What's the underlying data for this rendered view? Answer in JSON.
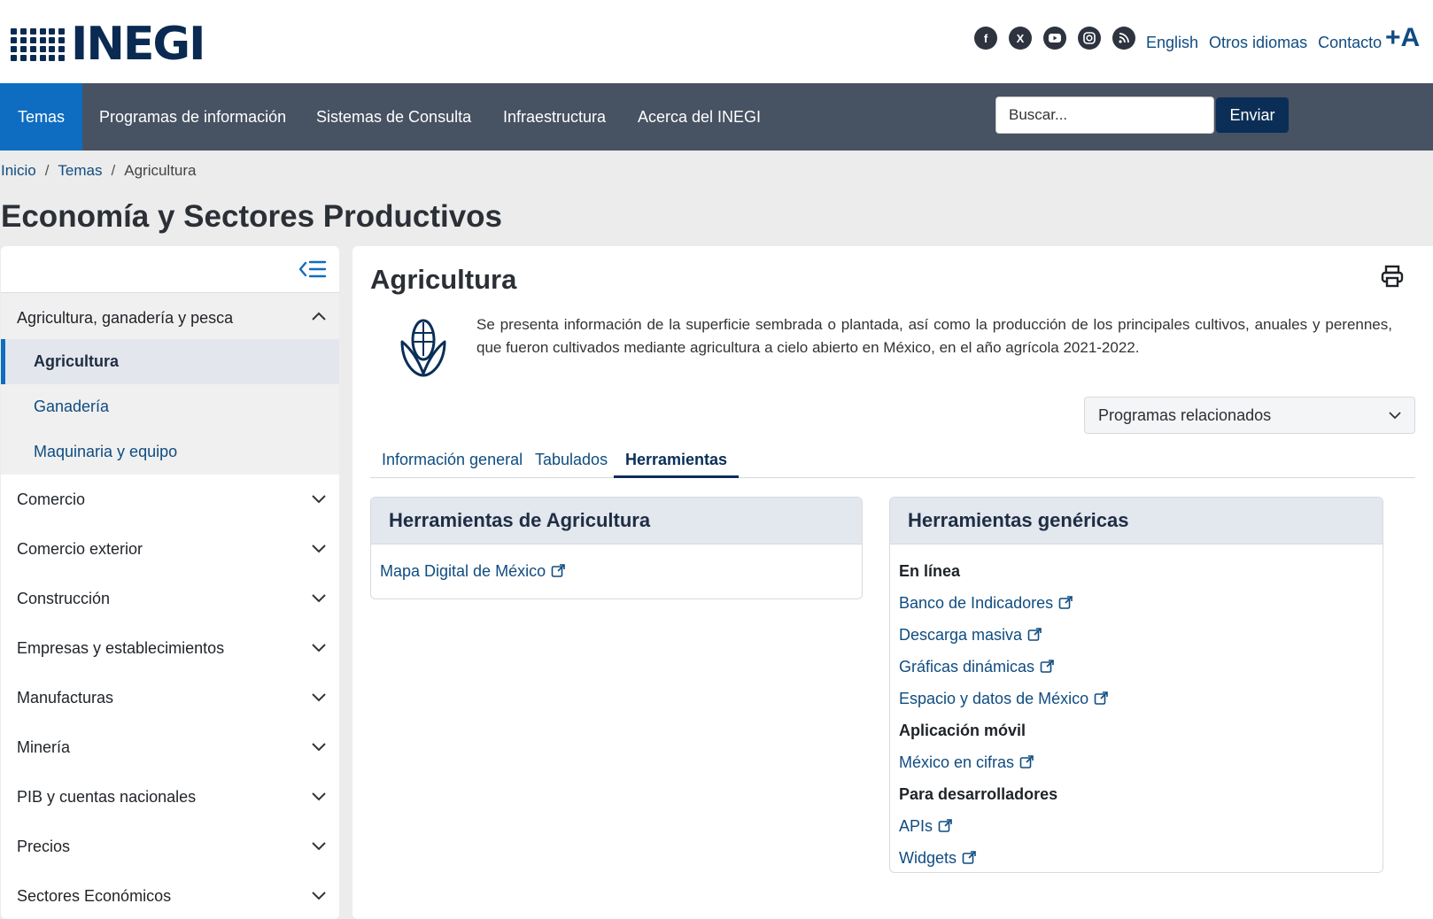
{
  "header": {
    "logo_text": "INEGI",
    "social_icons": [
      "facebook-icon",
      "x-icon",
      "youtube-icon",
      "instagram-icon",
      "rss-icon"
    ],
    "links": {
      "english": "English",
      "other_languages": "Otros idiomas",
      "contact": "Contacto",
      "font_size": "+A"
    }
  },
  "nav": {
    "items": [
      "Temas",
      "Programas de información",
      "Sistemas de Consulta",
      "Infraestructura",
      "Acerca del INEGI"
    ],
    "search": {
      "placeholder": "Buscar...",
      "button": "Enviar"
    }
  },
  "breadcrumb": {
    "home": "Inicio",
    "topics": "Temas",
    "current": "Agricultura"
  },
  "page_title": "Economía y Sectores Productivos",
  "sidebar": {
    "open_category": "Agricultura, ganadería y pesca",
    "subitems": [
      "Agricultura",
      "Ganadería",
      "Maquinaria y equipo"
    ],
    "categories": [
      "Comercio",
      "Comercio exterior",
      "Construcción",
      "Empresas y establecimientos",
      "Manufacturas",
      "Minería",
      "PIB y cuentas nacionales",
      "Precios",
      "Sectores Económicos"
    ]
  },
  "main": {
    "title": "Agricultura",
    "description": "Se presenta información de la superficie sembrada o plantada, así como la producción de los principales cultivos, anuales y perennes, que fueron cultivados mediante agricultura a cielo abierto en México, en el año agrícola 2021-2022.",
    "related_select": "Programas relacionados",
    "tabs": [
      "Información general",
      "Tabulados",
      "Herramientas"
    ],
    "active_tab": "Herramientas",
    "card_left": {
      "title": "Herramientas de Agricultura",
      "links": [
        "Mapa Digital de México"
      ]
    },
    "card_right": {
      "title": "Herramientas genéricas",
      "section_online": "En línea",
      "online_links": [
        "Banco de Indicadores",
        "Descarga masiva",
        "Gráficas dinámicas",
        "Espacio y datos de México"
      ],
      "section_mobile": "Aplicación móvil",
      "mobile_links": [
        "México en cifras"
      ],
      "section_dev": "Para desarrolladores",
      "dev_links": [
        "APIs",
        "Widgets"
      ]
    }
  }
}
